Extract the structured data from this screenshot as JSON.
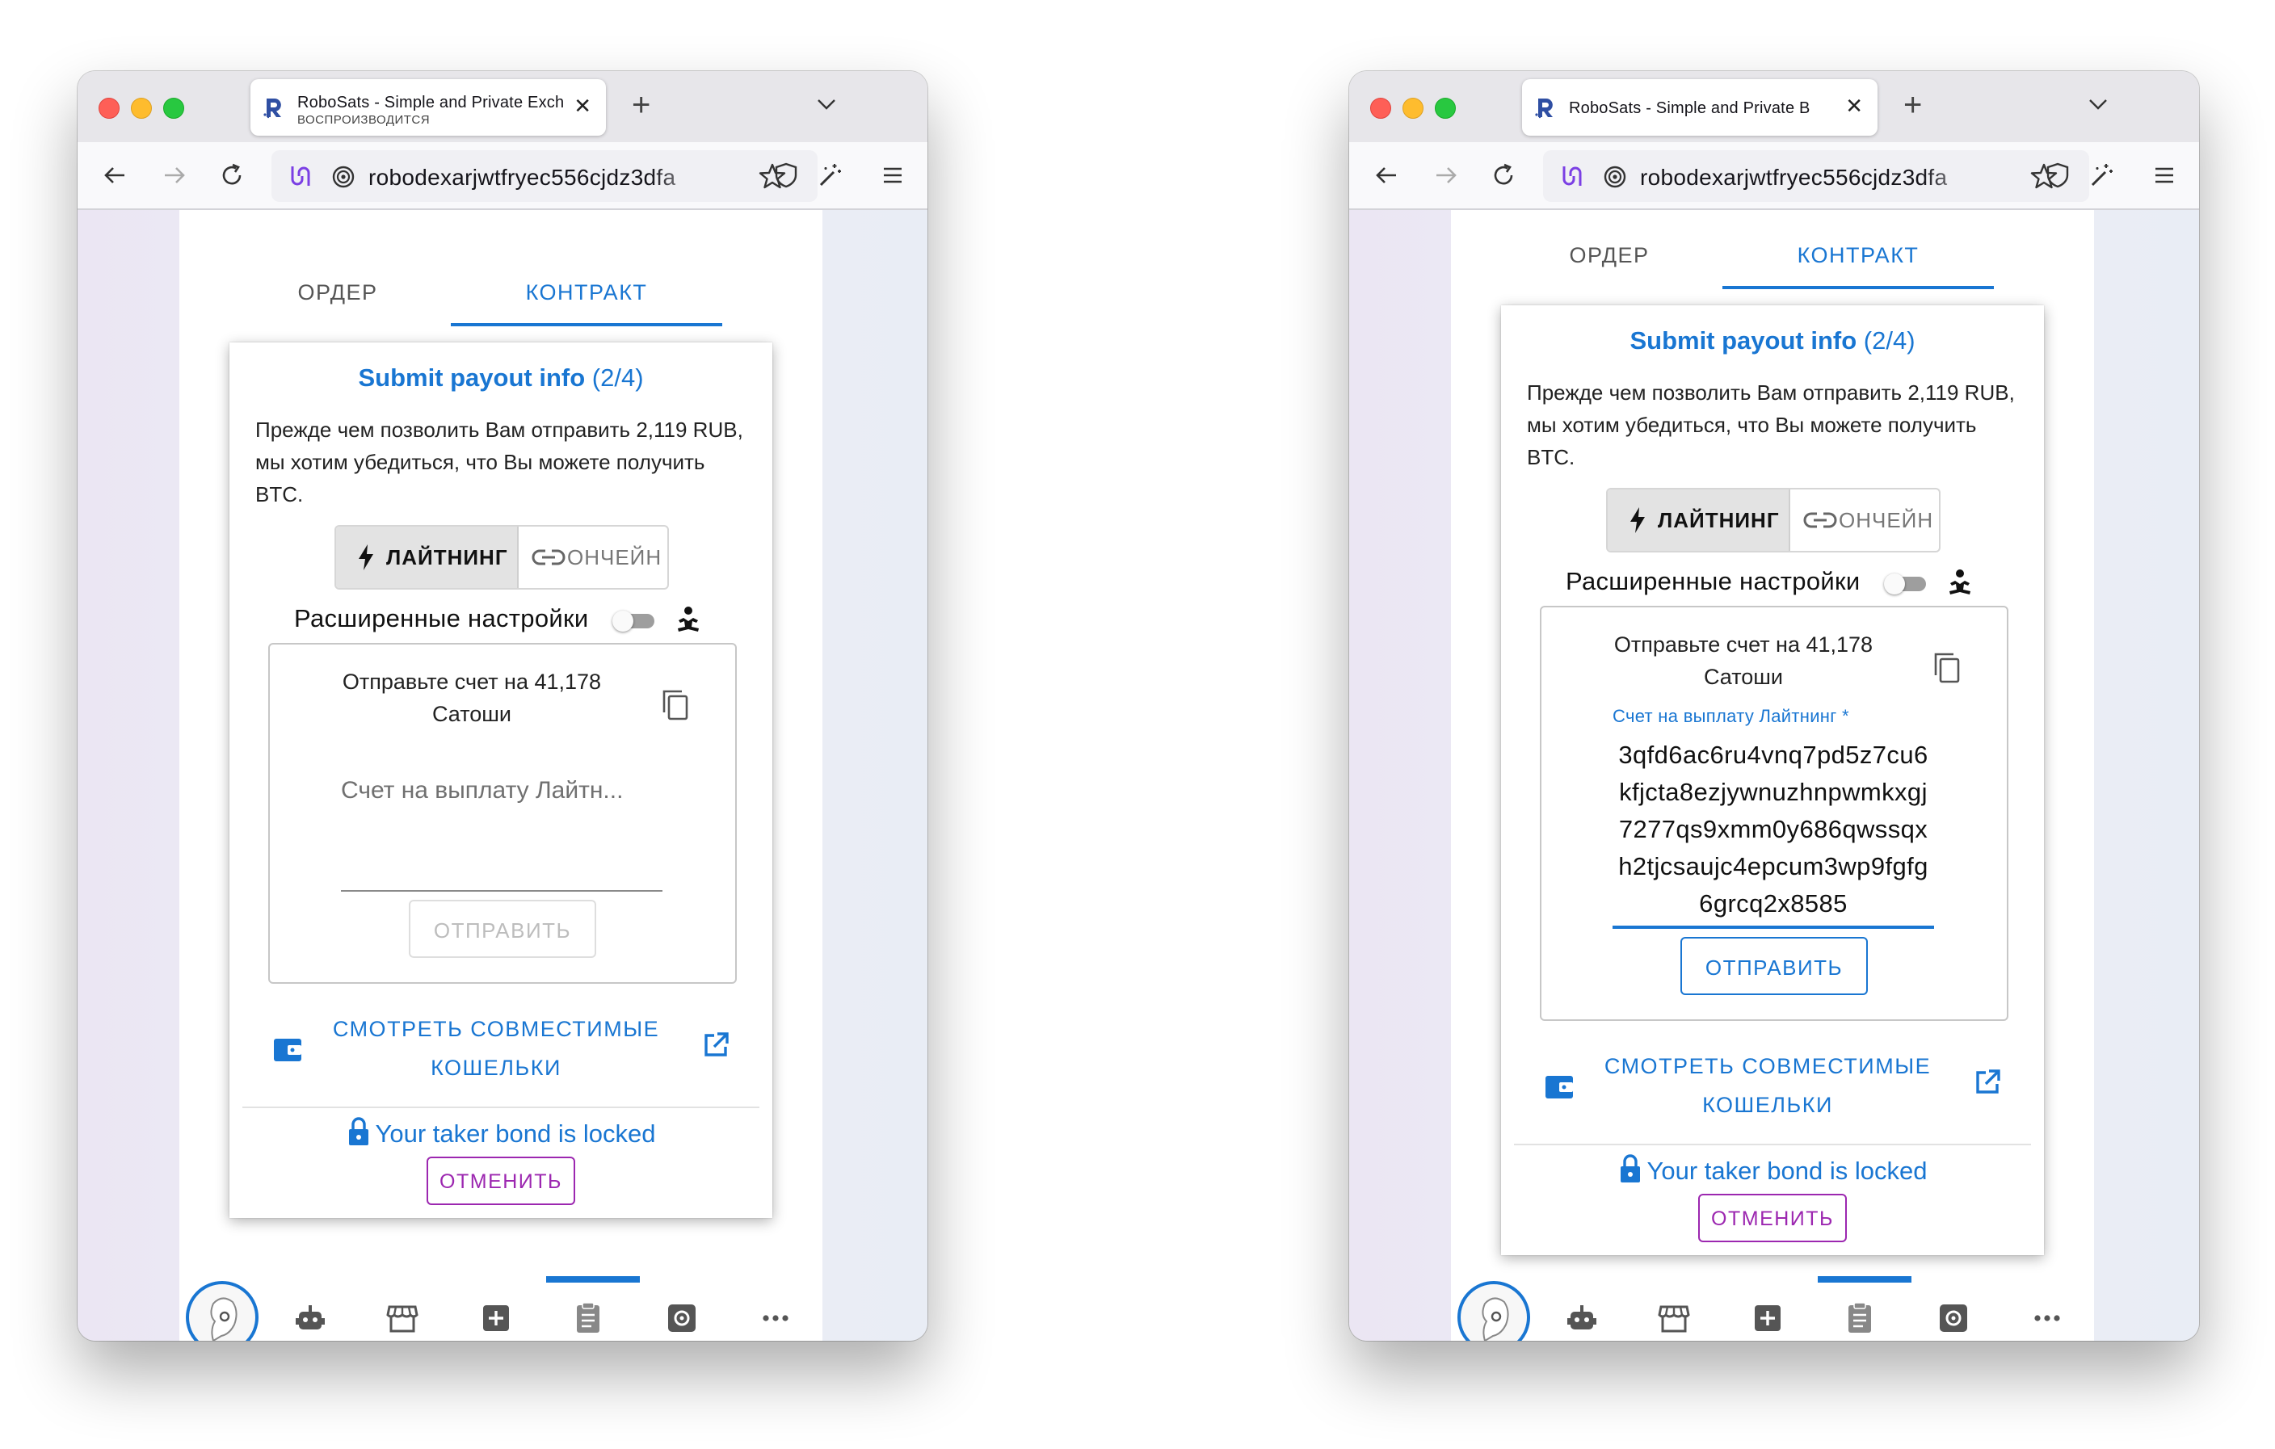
{
  "windows": [
    {
      "tab": {
        "title": "RoboSats - Simple and Private Exchange",
        "subtitle": "ВОСПРОИЗВОДИТСЯ"
      },
      "address_bar": {
        "url": "robodexarjwtfryec556cjdz3dfa"
      },
      "app_tabs": {
        "order": "ОРДЕР",
        "contract": "КОНТРАКТ"
      },
      "card": {
        "title_bold": "Submit payout info",
        "title_step": "(2/4)",
        "description": "Прежде чем позволить Вам отправить 2,119 RUB, мы хотим убедиться, что Вы можете получить BTC.",
        "method_toggle": {
          "lightning": "ЛАЙТНИНГ",
          "onchain": "ОНЧЕЙН",
          "selected": "lightning"
        },
        "advanced_settings": {
          "label": "Расширенные настройки",
          "enabled": false
        },
        "invoice_box": {
          "send_text": "Отправьте счет на 41,178 Сатоши",
          "field_placeholder": "Счет на выплату Лайтн...",
          "submit_label": "ОТПРАВИТЬ",
          "submit_enabled": false
        },
        "wallets_link": "СМОТРЕТЬ СОВМЕСТИМЫЕ КОШЕЛЬКИ",
        "bond_status": "Your taker bond is locked",
        "cancel_label": "ОТМЕНИТЬ"
      }
    },
    {
      "tab": {
        "title": "RoboSats - Simple and Private B"
      },
      "address_bar": {
        "url": "robodexarjwtfryec556cjdz3dfa"
      },
      "app_tabs": {
        "order": "ОРДЕР",
        "contract": "КОНТРАКТ"
      },
      "card": {
        "title_bold": "Submit payout info",
        "title_step": "(2/4)",
        "description": "Прежде чем позволить Вам отправить 2,119 RUB, мы хотим убедиться, что Вы можете получить BTC.",
        "method_toggle": {
          "lightning": "ЛАЙТНИНГ",
          "onchain": "ОНЧЕЙН",
          "selected": "lightning"
        },
        "advanced_settings": {
          "label": "Расширенные настройки",
          "enabled": false
        },
        "invoice_box": {
          "send_text": "Отправьте счет на 41,178 Сатоши",
          "field_label": "Счет на выплату Лайтнинг *",
          "field_value": "3qfd6ac6ru4vnq7pd5z7cu6kfjcta8ezjywnuzhnpwmkxgj7277qs9xmm0y686qwssqxh2tjcsaujc4epcum3wp9fgfg6grcq2x8585",
          "submit_label": "ОТПРАВИТЬ",
          "submit_enabled": true
        },
        "wallets_link": "СМОТРЕТЬ СОВМЕСТИМЫЕ КОШЕЛЬКИ",
        "bond_status": "Your taker bond is locked",
        "cancel_label": "ОТМЕНИТЬ"
      }
    }
  ],
  "bottom_nav": {
    "items": [
      "avatar",
      "robot-icon",
      "market-icon",
      "plus-icon",
      "order-clipboard-icon",
      "settings-icon",
      "more-icon"
    ],
    "active": "order-clipboard-icon"
  },
  "colors": {
    "accent": "#1976d2",
    "cancel": "#9c27b0",
    "mac_red": "#fe5f57",
    "mac_yellow": "#febc2e",
    "mac_green": "#28c840"
  }
}
